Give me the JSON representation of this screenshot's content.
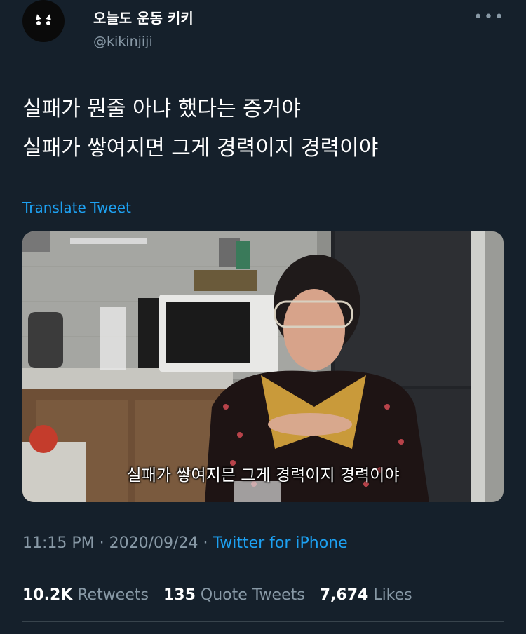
{
  "author": {
    "display_name": "오늘도 운동 키키",
    "handle": "@kikinjiji"
  },
  "tweet": {
    "lines": [
      "실패가 뭔줄 아냐 했다는 증거야",
      "실패가 쌓여지면 그게 경력이지 경력이야"
    ],
    "translate_label": "Translate Tweet",
    "media_caption": "실패가 쌓여지믄 그게 경력이지 경력이야"
  },
  "meta": {
    "time": "11:15 PM",
    "sep1": " · ",
    "date": "2020/09/24",
    "sep2": " · ",
    "source": "Twitter for iPhone"
  },
  "stats": {
    "retweets_count": "10.2K",
    "retweets_label": "Retweets",
    "quotes_count": "135",
    "quotes_label": "Quote Tweets",
    "likes_count": "7,674",
    "likes_label": "Likes"
  },
  "icons": {
    "more": "more-horizontal-icon"
  },
  "colors": {
    "background": "#15202b",
    "link": "#1da1f2",
    "secondary_text": "#8899a6",
    "divider": "#38444d"
  }
}
